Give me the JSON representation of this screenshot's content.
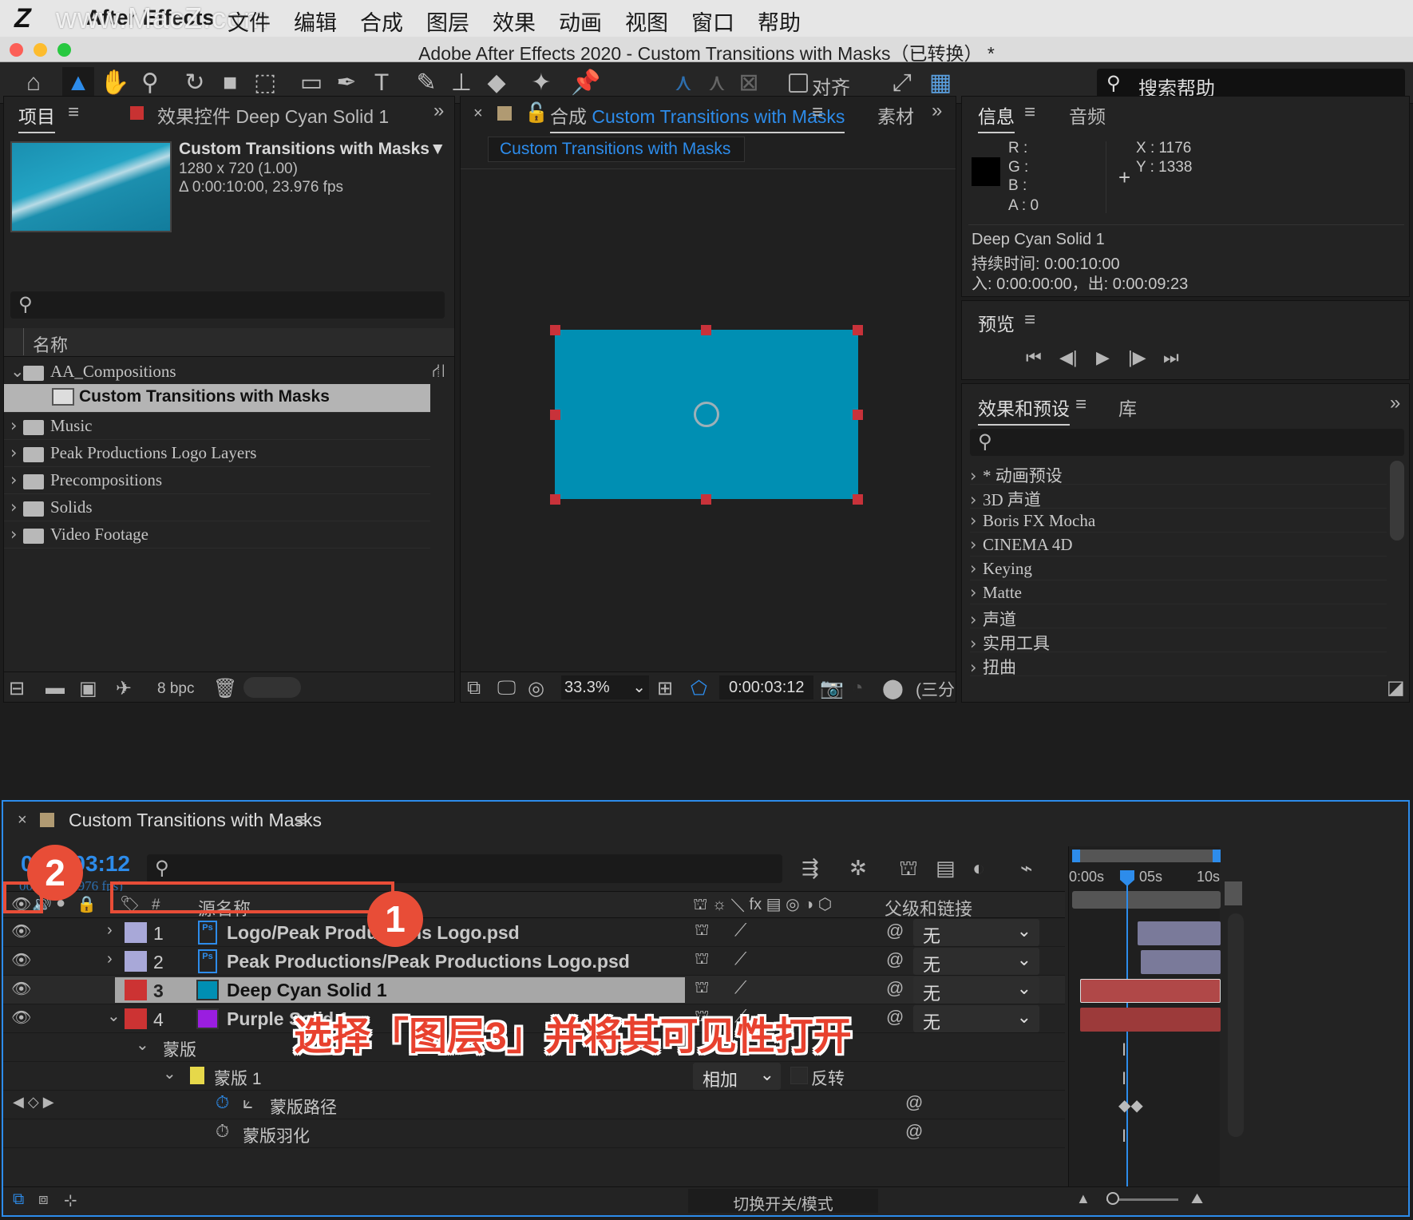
{
  "menubar": {
    "watermark": "www.MacZ.com",
    "app_name": "After Effects",
    "items": [
      "文件",
      "编辑",
      "合成",
      "图层",
      "效果",
      "动画",
      "视图",
      "窗口",
      "帮助"
    ]
  },
  "window": {
    "title": "Adobe After Effects 2020 - Custom Transitions with Masks（已转换） *"
  },
  "toolbar": {
    "align_label": "对齐",
    "search_placeholder": "搜索帮助"
  },
  "project_panel": {
    "tab_project": "项目",
    "tab_effects": "效果控件 Deep Cyan Solid 1",
    "comp_name": "Custom Transitions with Masks▼",
    "comp_size": "1280 x 720 (1.00)",
    "comp_duration": "Δ 0:00:10:00, 23.976 fps",
    "column_name": "名称",
    "items": [
      {
        "label": "AA_Compositions",
        "expanded": true
      },
      {
        "label": "Custom Transitions with Masks",
        "selected": true
      },
      {
        "label": "Music"
      },
      {
        "label": "Peak Productions Logo Layers"
      },
      {
        "label": "Precompositions"
      },
      {
        "label": "Solids"
      },
      {
        "label": "Video Footage"
      }
    ],
    "bpc": "8 bpc"
  },
  "comp_panel": {
    "tab_label": "合成",
    "tab_comp": "Custom Transitions with Masks",
    "tab_footage": "素材",
    "sub_tab": "Custom Transitions with Masks",
    "zoom": "33.3%",
    "timecode": "0:00:03:12",
    "view": "(三分",
    "solid_color": "#008fb3"
  },
  "info_panel": {
    "tab_info": "信息",
    "tab_audio": "音频",
    "r": "R :",
    "g": "G :",
    "b": "B :",
    "a": "A :  0",
    "x": "X : 1176",
    "y": "Y : 1338",
    "layer_name": "Deep Cyan Solid 1",
    "duration": "持续时间: 0:00:10:00",
    "in_out": "入: 0:00:00:00，出: 0:00:09:23"
  },
  "preview_panel": {
    "title": "预览"
  },
  "effects_panel": {
    "tab_effects": "效果和预设",
    "tab_library": "库",
    "items": [
      "* 动画预设",
      "3D 声道",
      "Boris FX Mocha",
      "CINEMA 4D",
      "Keying",
      "Matte",
      "声道",
      "实用工具",
      "扭曲"
    ]
  },
  "timeline": {
    "tab": "Custom Transitions with Masks",
    "timecode": "0:00:03:12",
    "frame_info": "00084 (23.976 fps)",
    "col_num": "#",
    "col_source": "源名称",
    "col_parent": "父级和链接",
    "ruler": [
      "0:00s",
      "05s",
      "10s"
    ],
    "layers": [
      {
        "num": "1",
        "name": "Logo/Peak Productions Logo.psd",
        "label_color": "#a8a8d8",
        "type": "Ps",
        "parent": "无"
      },
      {
        "num": "2",
        "name": "Peak Productions/Peak Productions Logo.psd",
        "label_color": "#a8a8d8",
        "type": "Ps",
        "parent": "无"
      },
      {
        "num": "3",
        "name": "Deep Cyan Solid 1",
        "label_color": "#cc3333",
        "swatch": "#008fb3",
        "parent": "无"
      },
      {
        "num": "4",
        "name": "Purple Solid 1",
        "label_color": "#cc3333",
        "swatch": "#9a1ee0",
        "parent": "无"
      }
    ],
    "mask_group": "蒙版",
    "mask_name": "蒙版 1",
    "mask_mode": "相加",
    "invert": "反转",
    "mask_path": "蒙版路径",
    "mask_feather": "蒙版羽化",
    "toggle_label": "切换开关/模式"
  },
  "annotations": {
    "callout_1": "1",
    "callout_2": "2",
    "caption": "选择「图层3」并将其可见性打开",
    "accent": "#e84d37"
  }
}
